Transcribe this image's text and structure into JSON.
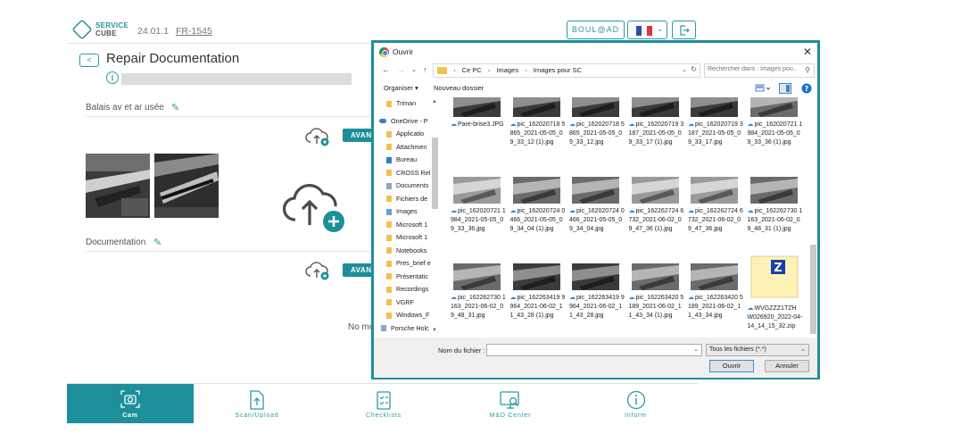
{
  "header": {
    "logo_line1": "SERVICE",
    "logo_line2": "CUBE",
    "version": "24.01.1",
    "ticket": "FR-1545",
    "user_button": "BOUL@AD",
    "language_flag": "fr-flag-icon",
    "logout_icon": "logout-icon"
  },
  "page": {
    "back_label": "<",
    "title": "Repair Documentation",
    "section1_label": "Balais av et ar usée",
    "section2_label": "Documentation",
    "avant_label": "AVAN",
    "no_media_text": "No me"
  },
  "bottom_nav": [
    {
      "label": "Cam",
      "icon": "camera-icon",
      "active": true
    },
    {
      "label": "Scan/Upload",
      "icon": "upload-file-icon",
      "active": false
    },
    {
      "label": "Checklists",
      "icon": "checklist-icon",
      "active": false
    },
    {
      "label": "M&D Center",
      "icon": "monitor-search-icon",
      "active": false
    },
    {
      "label": "Inform",
      "icon": "info-icon",
      "active": false
    }
  ],
  "dialog": {
    "title": "Ouvrir",
    "address": [
      "Ce PC",
      "Images",
      "Images pour SC"
    ],
    "search_placeholder": "Rechercher dans : Images pou...",
    "toolbar": {
      "organize": "Organiser ▾",
      "new_folder": "Nouveau dossier"
    },
    "nav_items": [
      {
        "label": "Triman",
        "type": "folder"
      },
      {
        "label": "OneDrive - P",
        "type": "cloud"
      },
      {
        "label": "Applicatio",
        "type": "folder"
      },
      {
        "label": "Attachmen",
        "type": "folder"
      },
      {
        "label": "Bureau",
        "type": "desktop"
      },
      {
        "label": "CROSS Rel",
        "type": "folder"
      },
      {
        "label": "Documents",
        "type": "doc"
      },
      {
        "label": "Fichiers de",
        "type": "folder"
      },
      {
        "label": "Images",
        "type": "images"
      },
      {
        "label": "Microsoft 1",
        "type": "folder"
      },
      {
        "label": "Microsoft 1",
        "type": "folder"
      },
      {
        "label": "Notebooks",
        "type": "folder"
      },
      {
        "label": "Pres_brief e",
        "type": "folder"
      },
      {
        "label": "Présentatic",
        "type": "folder"
      },
      {
        "label": "Recordings",
        "type": "folder"
      },
      {
        "label": "VGRF",
        "type": "folder"
      },
      {
        "label": "Windows_F",
        "type": "folder"
      },
      {
        "label": "Porsche Holc",
        "type": "doc"
      }
    ],
    "files": [
      {
        "name": "Pare-brise3.JPG",
        "cloud": true,
        "tone": "dark"
      },
      {
        "name": "pic_162020718 5865_2021-05-05_09_33_12 (1).jpg",
        "cloud": true,
        "tone": "dark"
      },
      {
        "name": "pic_162020718 5865_2021-05-05_09_33_12.jpg",
        "cloud": true,
        "tone": "dark"
      },
      {
        "name": "pic_162020719 3187_2021-05-05_09_33_17 (1).jpg",
        "cloud": true,
        "tone": "dark"
      },
      {
        "name": "pic_162020719 3187_2021-05-05_09_33_17.jpg",
        "cloud": true,
        "tone": "dark"
      },
      {
        "name": "pic_162020721 1984_2021-05-05_09_33_36 (1).jpg",
        "cloud": true,
        "tone": "mid"
      },
      {
        "name": "pic_162020721 1984_2021-05-05_09_33_36.jpg",
        "cloud": true,
        "tone": "light"
      },
      {
        "name": "pic_162020724 0466_2021-05-05_09_34_04 (1).jpg",
        "cloud": true,
        "tone": "mid"
      },
      {
        "name": "pic_162020724 0466_2021-05-05_09_34_04.jpg",
        "cloud": true,
        "tone": "mid"
      },
      {
        "name": "pic_162262724 6732_2021-06-02_09_47_36 (1).jpg",
        "cloud": true,
        "tone": "light"
      },
      {
        "name": "pic_162262724 6732_2021-06-02_09_47_36.jpg",
        "cloud": true,
        "tone": "light"
      },
      {
        "name": "pic_162262730 1163_2021-06-02_09_48_31 (1).jpg",
        "cloud": true,
        "tone": "mid"
      },
      {
        "name": "pic_162262730 1163_2021-06-02_09_48_31.jpg",
        "cloud": true,
        "tone": "mid"
      },
      {
        "name": "pic_162263419 9964_2021-06-02_11_43_28 (1).jpg",
        "cloud": true,
        "tone": "dark"
      },
      {
        "name": "pic_162263419 9964_2021-06-02_11_43_28.jpg",
        "cloud": true,
        "tone": "dark"
      },
      {
        "name": "pic_162263420 5189_2021-06-02_11_43_34 (1).jpg",
        "cloud": true,
        "tone": "mid"
      },
      {
        "name": "pic_162263420 5189_2021-06-02_11_43_34.jpg",
        "cloud": true,
        "tone": "mid"
      },
      {
        "name": "WVGZZZ1TZH W026920_2022-04-14_14_15_32.zip",
        "cloud": true,
        "tone": "zip"
      }
    ],
    "filename_label": "Nom du fichier :",
    "filename_value": "",
    "filter_value": "Tous les fichiers (*.*)",
    "open_button": "Ouvrir",
    "cancel_button": "Annuler"
  }
}
